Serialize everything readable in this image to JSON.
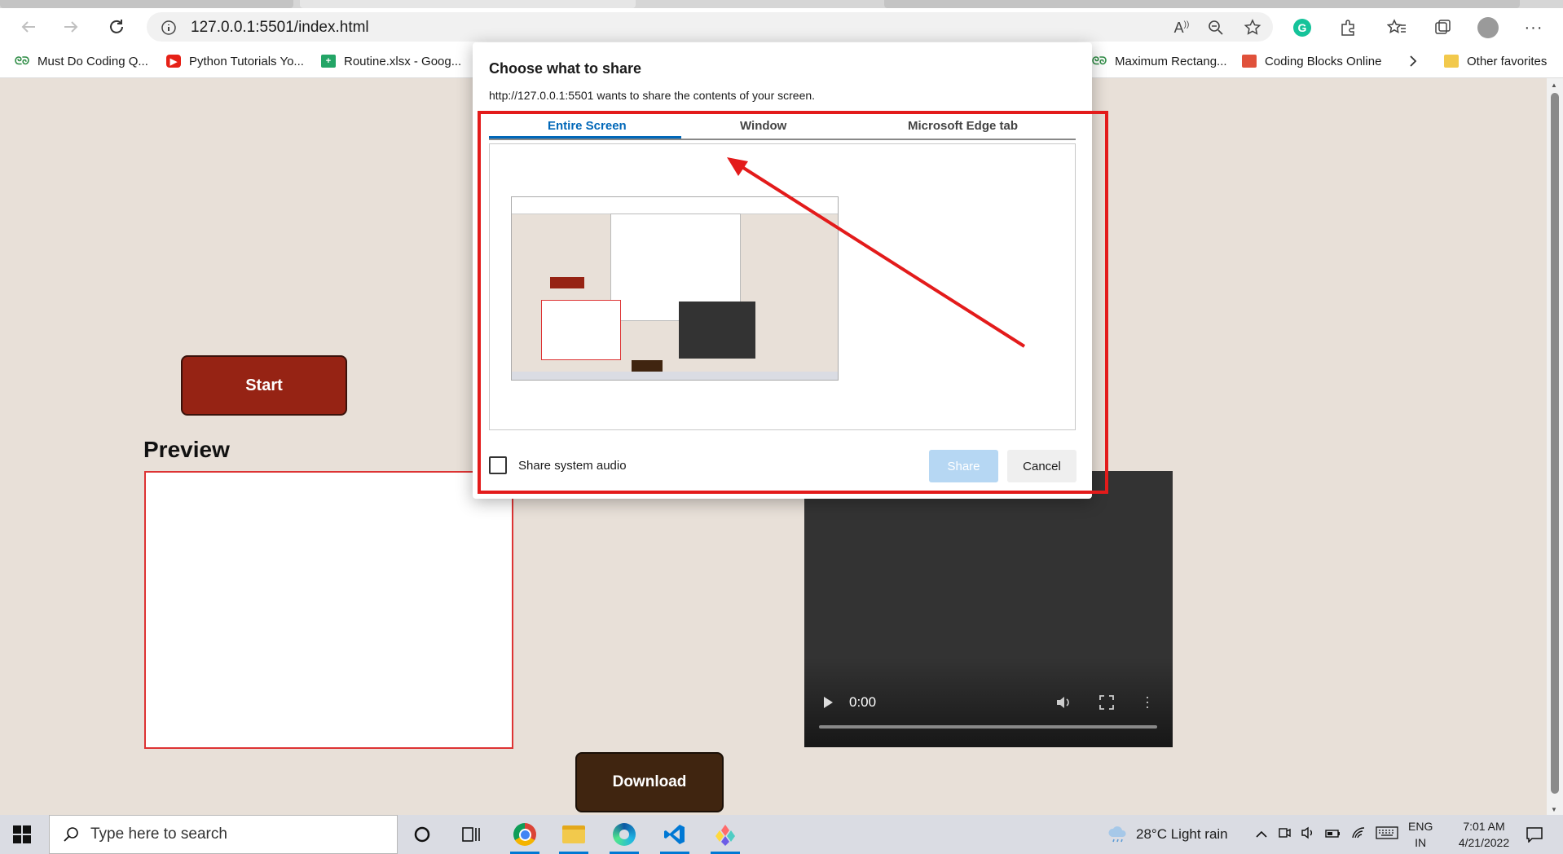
{
  "browser": {
    "url": "127.0.0.1:5501/index.html",
    "bookmarks": [
      {
        "label": "Must Do Coding Q...",
        "icon": "geeksforgeeks-icon"
      },
      {
        "label": "Python Tutorials Yo...",
        "icon": "youtube-icon"
      },
      {
        "label": "Routine.xlsx - Goog...",
        "icon": "google-sheets-icon"
      },
      {
        "label": "Maximum Rectang...",
        "icon": "geeksforgeeks-icon"
      },
      {
        "label": "Coding Blocks Online",
        "icon": "coding-blocks-icon"
      }
    ],
    "other_favorites": "Other favorites"
  },
  "page": {
    "start_label": "Start",
    "preview_title": "Preview",
    "download_label": "Download",
    "video_time": "0:00"
  },
  "dialog": {
    "title": "Choose what to share",
    "subtitle": "http://127.0.0.1:5501 wants to share the contents of your screen.",
    "tabs": [
      "Entire Screen",
      "Window",
      "Microsoft Edge tab"
    ],
    "active_tab": "Entire Screen",
    "share_audio_label": "Share system audio",
    "share_label": "Share",
    "cancel_label": "Cancel"
  },
  "taskbar": {
    "search_placeholder": "Type here to search",
    "weather": "28°C  Light rain",
    "lang_top": "ENG",
    "lang_bottom": "IN",
    "time": "7:01 AM",
    "date": "4/21/2022"
  },
  "colors": {
    "page_bg": "#e8e0d8",
    "start_button": "#962314",
    "download_button": "#402510",
    "annotation_red": "#e31b1b",
    "accent_blue": "#0067b8"
  }
}
